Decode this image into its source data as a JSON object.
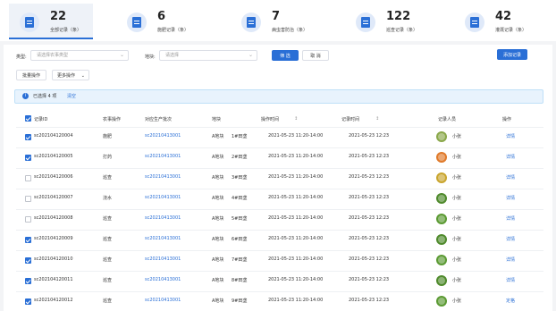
{
  "stats": [
    {
      "value": "22",
      "label": "全部记录（条）"
    },
    {
      "value": "6",
      "label": "施肥记录（条）"
    },
    {
      "value": "7",
      "label": "病虫害防治（条）"
    },
    {
      "value": "122",
      "label": "巡查记录（条）"
    },
    {
      "value": "42",
      "label": "灌溉记录（条）"
    }
  ],
  "filters": {
    "type_label": "类型:",
    "type_placeholder": "请选择农事类型",
    "plot_label": "地块:",
    "plot_placeholder": "请选择",
    "search_label": "筛 选",
    "cancel_label": "取 消",
    "add_label": "添加记录"
  },
  "actions": {
    "batch_label": "批量操作",
    "more_label": "更多操作"
  },
  "selection": {
    "text": "已选择 4 项",
    "clear": "清空"
  },
  "table": {
    "headers": {
      "record": "记录ID",
      "type": "农事操作",
      "batch": "对应生产批次",
      "plot": "地块",
      "op_time": "操作时间",
      "rec_time": "记录时间",
      "person": "记录人员",
      "action": "操作"
    },
    "rows": [
      {
        "id": "sc202104120004",
        "checked": true,
        "type": "施肥",
        "batch": "sc20210413001",
        "plot": "A地块",
        "sub": "1#田垄",
        "op_time": "2021-05-23 11:20-14:00",
        "rec_time": "2021-05-23 12:23",
        "person": "小张",
        "action": "详情",
        "avatar": "#8aa84a"
      },
      {
        "id": "sc202104120005",
        "checked": true,
        "type": "打药",
        "batch": "sc20210413001",
        "plot": "A地块",
        "sub": "2#田垄",
        "op_time": "2021-05-23 11:20-14:00",
        "rec_time": "2021-05-23 12:23",
        "person": "小张",
        "action": "详情",
        "avatar": "#e07a2a"
      },
      {
        "id": "sc202104120006",
        "checked": false,
        "type": "巡查",
        "batch": "sc20210413001",
        "plot": "A地块",
        "sub": "3#田垄",
        "op_time": "2021-05-23 11:20-14:00",
        "rec_time": "2021-05-23 12:23",
        "person": "小张",
        "action": "详情",
        "avatar": "#c9a52e"
      },
      {
        "id": "sc202104120007",
        "checked": false,
        "type": "浇水",
        "batch": "sc20210413001",
        "plot": "A地块",
        "sub": "4#田垄",
        "op_time": "2021-05-23 11:20-14:00",
        "rec_time": "2021-05-23 12:23",
        "person": "小张",
        "action": "详情",
        "avatar": "#4f8a2c"
      },
      {
        "id": "sc202104120008",
        "checked": false,
        "type": "巡查",
        "batch": "sc20210413001",
        "plot": "A地块",
        "sub": "5#田垄",
        "op_time": "2021-05-23 11:20-14:00",
        "rec_time": "2021-05-23 12:23",
        "person": "小张",
        "action": "详情",
        "avatar": "#5b9a33"
      },
      {
        "id": "sc202104120009",
        "checked": true,
        "type": "巡查",
        "batch": "sc20210413001",
        "plot": "A地块",
        "sub": "6#田垄",
        "op_time": "2021-05-23 11:20-14:00",
        "rec_time": "2021-05-23 12:23",
        "person": "小张",
        "action": "详情",
        "avatar": "#4f8a2c"
      },
      {
        "id": "sc202104120010",
        "checked": true,
        "type": "巡查",
        "batch": "sc20210413001",
        "plot": "A地块",
        "sub": "7#田垄",
        "op_time": "2021-05-23 11:20-14:00",
        "rec_time": "2021-05-23 12:23",
        "person": "小张",
        "action": "详情",
        "avatar": "#5b9a33"
      },
      {
        "id": "sc202104120011",
        "checked": true,
        "type": "巡查",
        "batch": "sc20210413001",
        "plot": "A地块",
        "sub": "8#田垄",
        "op_time": "2021-05-23 11:20-14:00",
        "rec_time": "2021-05-23 12:23",
        "person": "小张",
        "action": "详情",
        "avatar": "#4f8a2c"
      },
      {
        "id": "sc202104120012",
        "checked": true,
        "type": "巡查",
        "batch": "sc20210413001",
        "plot": "A地块",
        "sub": "9#田垄",
        "op_time": "2021-05-23 11:20-14:00",
        "rec_time": "2021-05-23 12:23",
        "person": "小张",
        "action": "定格",
        "avatar": "#5b9a33"
      }
    ]
  },
  "colors": {
    "accent": "#2a6fd6"
  }
}
